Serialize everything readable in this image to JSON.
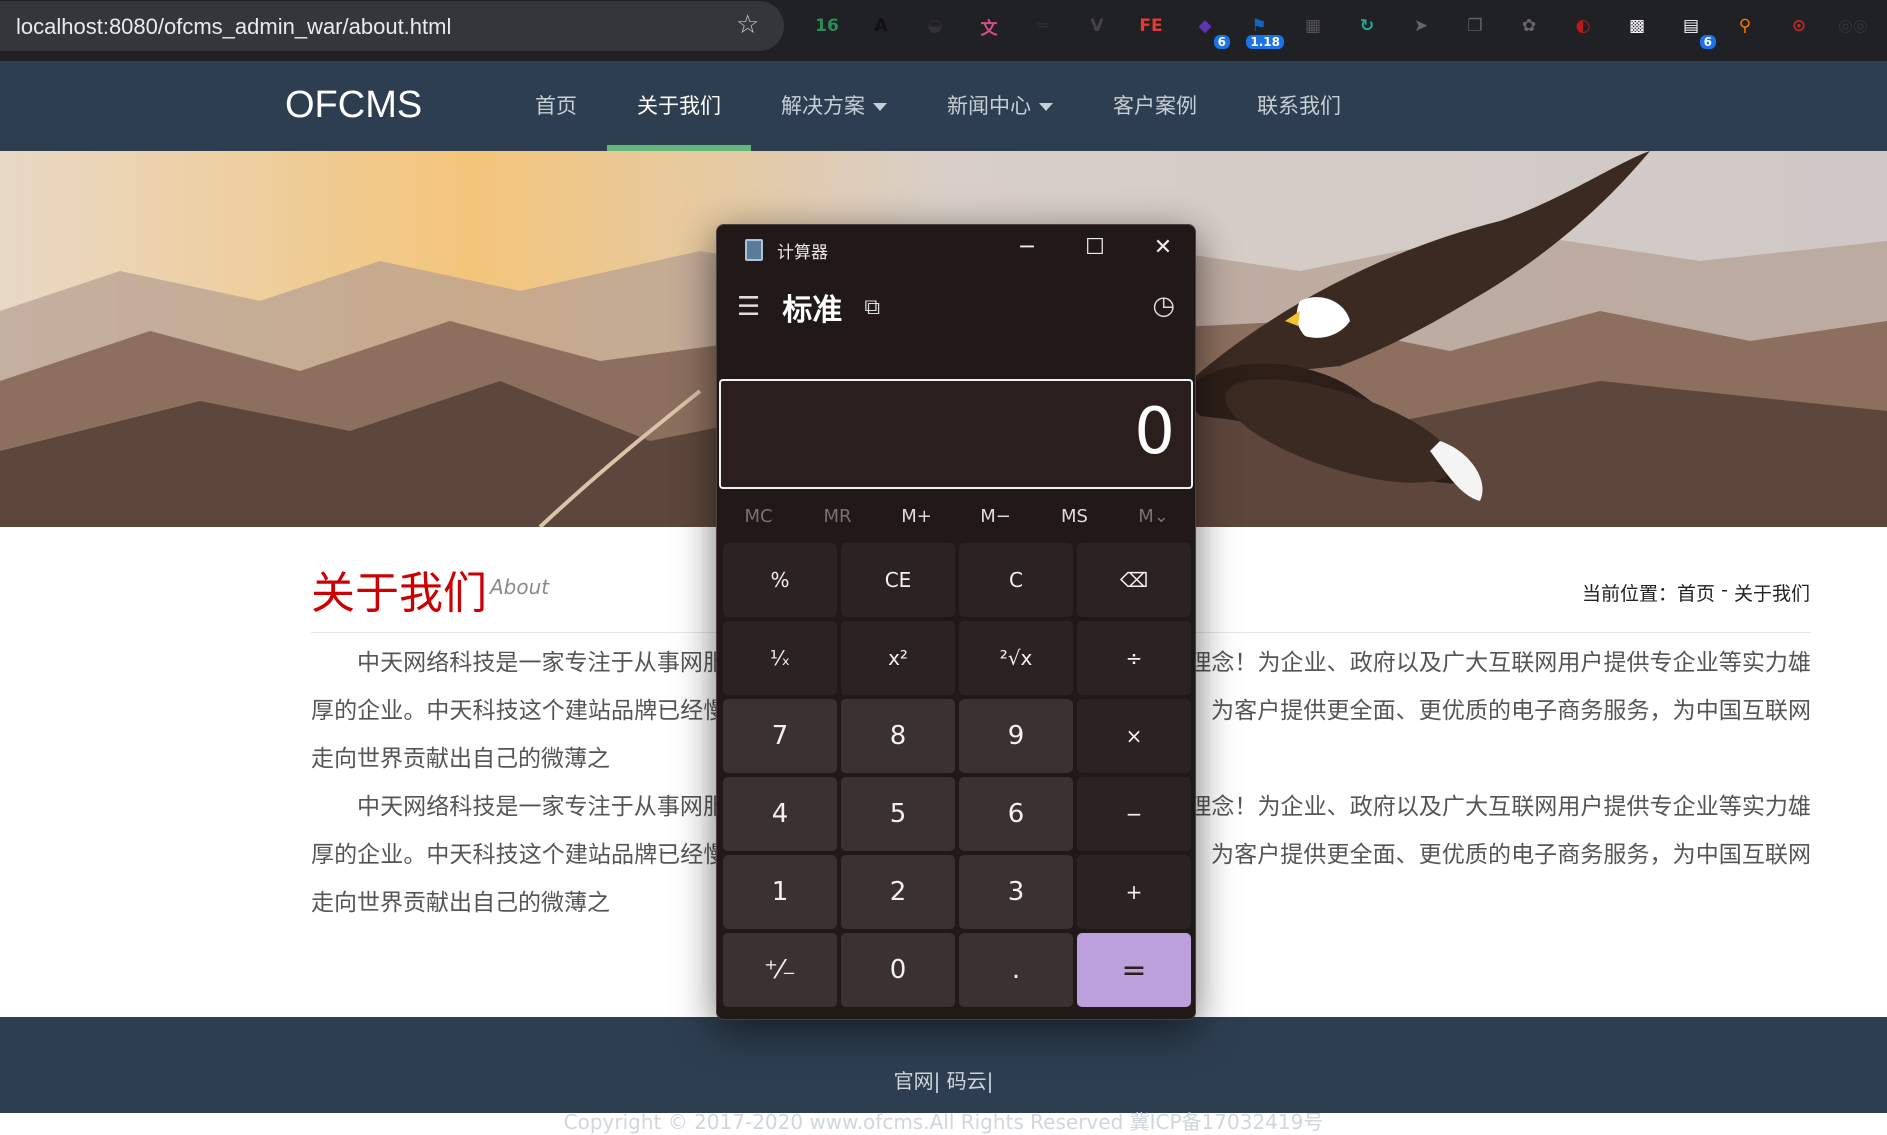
{
  "browser": {
    "url": "localhost:8080/ofcms_admin_war/about.html",
    "extensions": [
      {
        "name": "extension-16",
        "label": "16",
        "color": "#2e8b57"
      },
      {
        "name": "extension-a",
        "label": "A",
        "color": "#111111"
      },
      {
        "name": "extension-hat",
        "label": "◒",
        "color": "#333333"
      },
      {
        "name": "extension-translate",
        "label": "文",
        "color": "#d64b8c"
      },
      {
        "name": "extension-stripe",
        "label": "═",
        "color": "#263238"
      },
      {
        "name": "extension-v",
        "label": "V",
        "color": "#444444"
      },
      {
        "name": "extension-fe",
        "label": "FE",
        "color": "#e53935"
      },
      {
        "name": "extension-cube",
        "label": "◆",
        "color": "#5e35b1",
        "badge": "6"
      },
      {
        "name": "extension-flag",
        "label": "⚑",
        "color": "#1565c0",
        "badge": "1.18"
      },
      {
        "name": "extension-qr",
        "label": "▦",
        "color": "#555555"
      },
      {
        "name": "extension-refresh",
        "label": "↻",
        "color": "#26a69a"
      },
      {
        "name": "extension-arrow",
        "label": "➤",
        "color": "#666666"
      },
      {
        "name": "extension-copy",
        "label": "❐",
        "color": "#5f6368"
      },
      {
        "name": "extension-flower",
        "label": "✿",
        "color": "#666666"
      },
      {
        "name": "extension-spinner",
        "label": "◐",
        "color": "#b71c1c"
      },
      {
        "name": "extension-qr2",
        "label": "▩",
        "color": "#ffffff"
      },
      {
        "name": "extension-grid",
        "label": "▤",
        "color": "#ffffff",
        "badge": "6"
      },
      {
        "name": "extension-search",
        "label": "⚲",
        "color": "#f57c00"
      },
      {
        "name": "extension-record",
        "label": "⊙",
        "color": "#c62828"
      },
      {
        "name": "extension-glasses",
        "label": "◎◎",
        "color": "#333333"
      }
    ]
  },
  "site": {
    "logo": "OFCMS",
    "nav": [
      {
        "label": "首页",
        "active": false,
        "dropdown": false
      },
      {
        "label": "关于我们",
        "active": true,
        "dropdown": false
      },
      {
        "label": "解决方案",
        "active": false,
        "dropdown": true
      },
      {
        "label": "新闻中心",
        "active": false,
        "dropdown": true
      },
      {
        "label": "客户案例",
        "active": false,
        "dropdown": false
      },
      {
        "label": "联系我们",
        "active": false,
        "dropdown": false
      }
    ],
    "page_title": "关于我们",
    "page_subtitle": "About",
    "breadcrumb_label": "当前位置：",
    "breadcrumb_home": "首页",
    "breadcrumb_sep": " - ",
    "breadcrumb_current": "关于我们",
    "paragraphs": [
      "中天网络科技是一家专注于从事网服务公司。我们以“创新发展，合作共赢”为经营理念！为企业、政府以及广大互联网用户提供专企业等实力雄厚的企业。中天科技这个建站品牌已经慢慢深入企业的认识中，建网站，中天科技础上，为客户提供更全面、更优质的电子商务服务，为中国互联网走向世界贡献出自己的微薄之",
      "中天网络科技是一家专注于从事网服务公司。我们以“创新发展，合作共赢”为经营理念！为企业、政府以及广大互联网用户提供专企业等实力雄厚的企业。中天科技这个建站品牌已经慢慢深入企业的认识中，建网站，中天科技础上，为客户提供更全面、更优质的电子商务服务，为中国互联网走向世界贡献出自己的微薄之"
    ],
    "footer_links": "官网| 码云|",
    "footer_copyright": "Copyright © 2017-2020 www.ofcms.All Rights Reserved 冀ICP备17032419号"
  },
  "calculator": {
    "title": "计算器",
    "mode": "标准",
    "display": "0",
    "memory": [
      {
        "label": "MC",
        "enabled": false
      },
      {
        "label": "MR",
        "enabled": false
      },
      {
        "label": "M+",
        "enabled": true
      },
      {
        "label": "M−",
        "enabled": true
      },
      {
        "label": "MS",
        "enabled": true
      },
      {
        "label": "M⌄",
        "enabled": false
      }
    ],
    "keys": [
      {
        "label": "%",
        "kind": "fn",
        "name": "percent-key"
      },
      {
        "label": "CE",
        "kind": "fn",
        "name": "clear-entry-key"
      },
      {
        "label": "C",
        "kind": "fn",
        "name": "clear-key"
      },
      {
        "label": "⌫",
        "kind": "fn",
        "name": "backspace-key"
      },
      {
        "label": "¹⁄ₓ",
        "kind": "fn",
        "name": "reciprocal-key"
      },
      {
        "label": "x²",
        "kind": "fn",
        "name": "square-key"
      },
      {
        "label": "²√x",
        "kind": "fn",
        "name": "square-root-key"
      },
      {
        "label": "÷",
        "kind": "fn",
        "name": "divide-key"
      },
      {
        "label": "7",
        "kind": "num",
        "name": "digit-7-key"
      },
      {
        "label": "8",
        "kind": "num",
        "name": "digit-8-key"
      },
      {
        "label": "9",
        "kind": "num",
        "name": "digit-9-key"
      },
      {
        "label": "×",
        "kind": "fn",
        "name": "multiply-key"
      },
      {
        "label": "4",
        "kind": "num",
        "name": "digit-4-key"
      },
      {
        "label": "5",
        "kind": "num",
        "name": "digit-5-key"
      },
      {
        "label": "6",
        "kind": "num",
        "name": "digit-6-key"
      },
      {
        "label": "−",
        "kind": "fn",
        "name": "subtract-key"
      },
      {
        "label": "1",
        "kind": "num",
        "name": "digit-1-key"
      },
      {
        "label": "2",
        "kind": "num",
        "name": "digit-2-key"
      },
      {
        "label": "3",
        "kind": "num",
        "name": "digit-3-key"
      },
      {
        "label": "+",
        "kind": "fn",
        "name": "add-key"
      },
      {
        "label": "⁺⁄₋",
        "kind": "num",
        "name": "negate-key"
      },
      {
        "label": "0",
        "kind": "num",
        "name": "digit-0-key"
      },
      {
        "label": ".",
        "kind": "num",
        "name": "decimal-key"
      },
      {
        "label": "=",
        "kind": "eq",
        "name": "equals-key"
      }
    ]
  }
}
